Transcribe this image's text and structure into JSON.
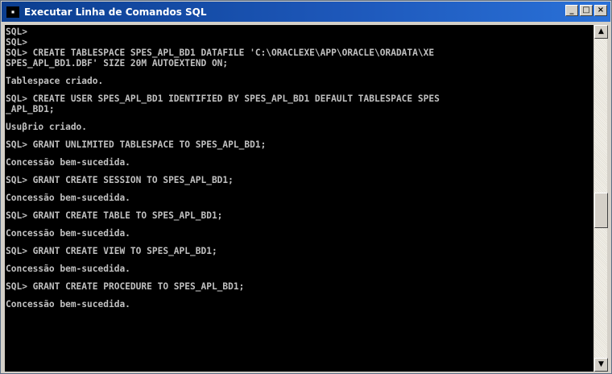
{
  "window": {
    "title": "Executar Linha de Comandos SQL",
    "icon": "terminal-icon",
    "buttons": {
      "minimize": "minimize-icon",
      "maximize": "maximize-icon",
      "close": "close-icon"
    }
  },
  "console": {
    "lines": [
      "SQL>",
      "SQL>",
      "SQL> CREATE TABLESPACE SPES_APL_BD1 DATAFILE 'C:\\ORACLEXE\\APP\\ORACLE\\ORADATA\\XE",
      "SPES_APL_BD1.DBF' SIZE 20M AUTOEXTEND ON;",
      "",
      "Tablespace criado.",
      "",
      "SQL> CREATE USER SPES_APL_BD1 IDENTIFIED BY SPES_APL_BD1 DEFAULT TABLESPACE SPES",
      "_APL_BD1;",
      "",
      "Usuβrio criado.",
      "",
      "SQL> GRANT UNLIMITED TABLESPACE TO SPES_APL_BD1;",
      "",
      "Concessão bem-sucedida.",
      "",
      "SQL> GRANT CREATE SESSION TO SPES_APL_BD1;",
      "",
      "Concessão bem-sucedida.",
      "",
      "SQL> GRANT CREATE TABLE TO SPES_APL_BD1;",
      "",
      "Concessão bem-sucedida.",
      "",
      "SQL> GRANT CREATE VIEW TO SPES_APL_BD1;",
      "",
      "Concessão bem-sucedida.",
      "",
      "SQL> GRANT CREATE PROCEDURE TO SPES_APL_BD1;",
      "",
      "Concessão bem-sucedida."
    ]
  },
  "scrollbar": {
    "up_icon": "arrow-up-icon",
    "down_icon": "arrow-down-icon"
  }
}
